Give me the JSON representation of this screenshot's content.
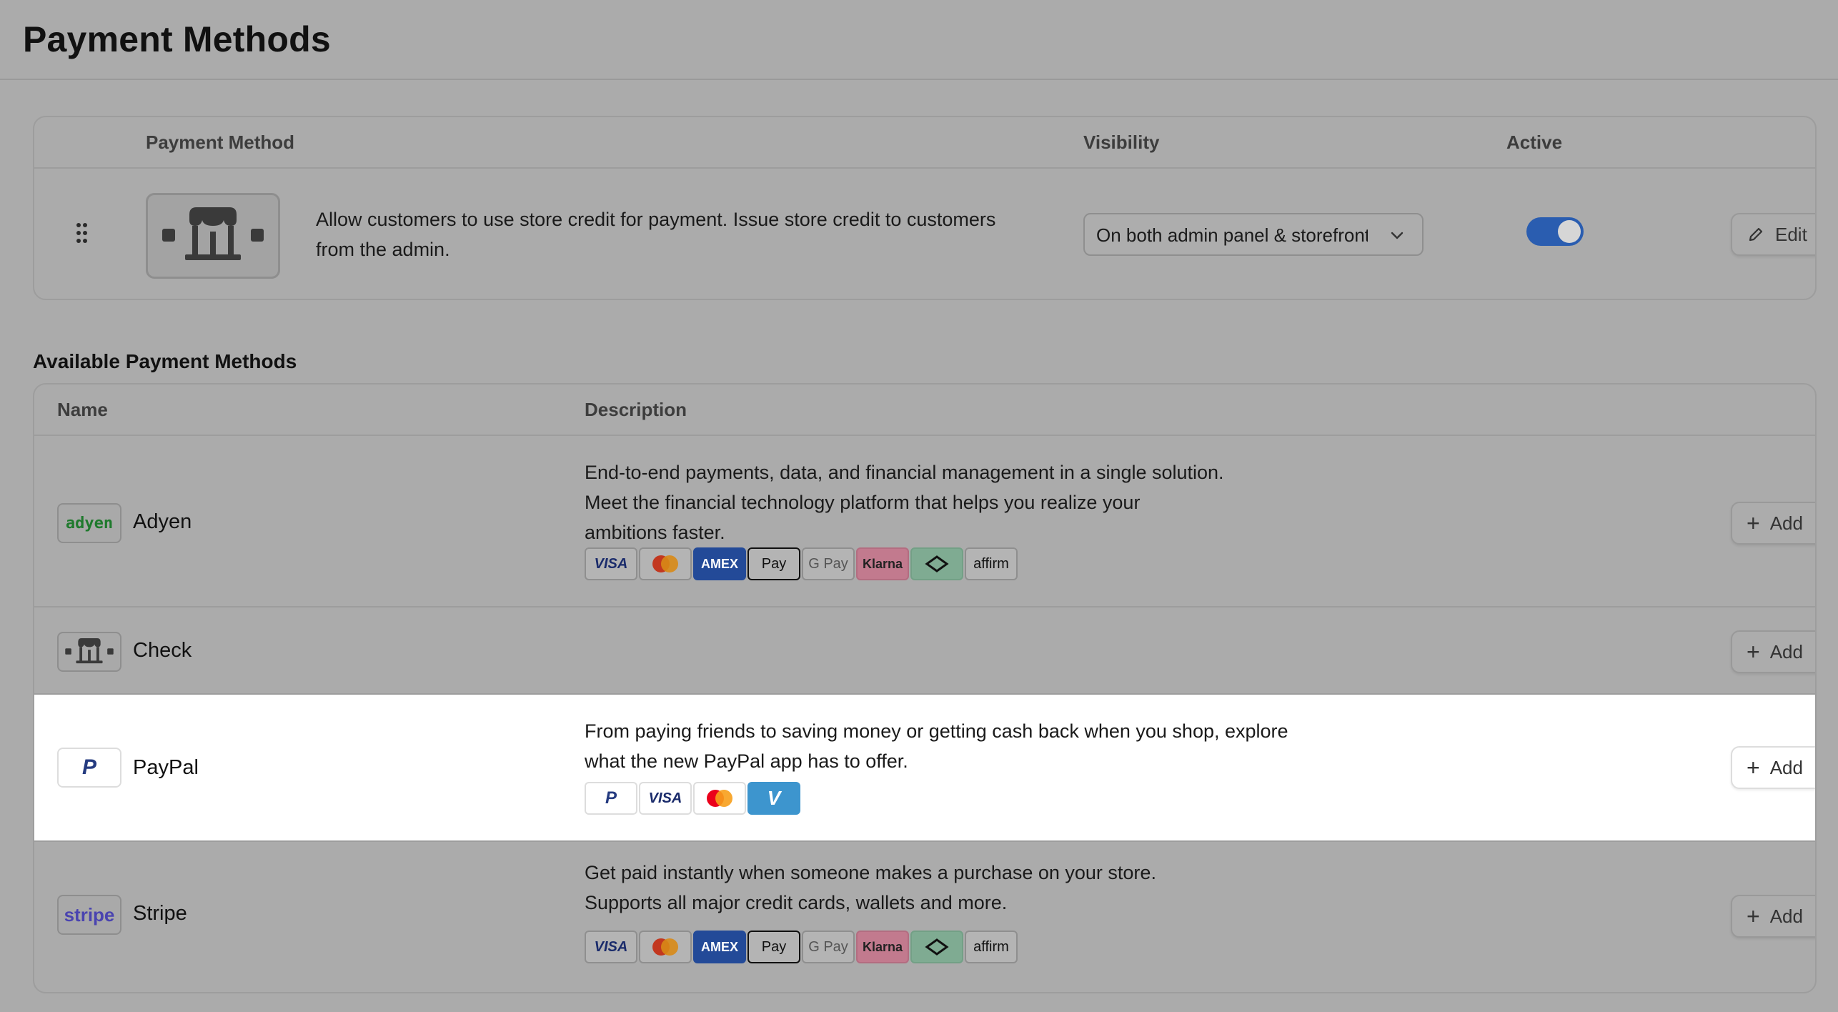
{
  "page": {
    "title": "Payment Methods"
  },
  "active_table": {
    "headers": {
      "method": "Payment Method",
      "visibility": "Visibility",
      "active": "Active"
    },
    "row": {
      "description": "Allow customers to use store credit for payment. Issue store credit to customers from the admin.",
      "visibility_value": "On both admin panel & storefront",
      "active": true,
      "edit_label": "Edit"
    }
  },
  "available": {
    "title": "Available Payment Methods",
    "headers": {
      "name": "Name",
      "description": "Description"
    },
    "add_label": "Add",
    "rows": [
      {
        "name": "Adyen",
        "logo_text": "adyen",
        "description": "End-to-end payments, data, and financial management in a single solution. Meet the financial technology platform that helps you realize your ambitions faster.",
        "icons": [
          "VISA",
          "mastercard",
          "AMEX",
          "Pay",
          "G Pay",
          "Klarna",
          "afterpay",
          "affirm"
        ]
      },
      {
        "name": "Check",
        "logo_text": "",
        "description": "",
        "icons": []
      },
      {
        "name": "PayPal",
        "logo_text": "P",
        "description": "From paying friends to saving money or getting cash back when you shop, explore what the new PayPal app has to offer.",
        "icons": [
          "P",
          "VISA",
          "mastercard",
          "V"
        ]
      },
      {
        "name": "Stripe",
        "logo_text": "stripe",
        "description": "Get paid instantly when someone makes a purchase on your store. Supports all major credit cards, wallets and more.",
        "icons": [
          "VISA",
          "mastercard",
          "AMEX",
          "Pay",
          "G Pay",
          "Klarna",
          "afterpay",
          "affirm"
        ]
      }
    ]
  },
  "colors": {
    "background": "#ababab",
    "toggle_on": "#2a5db0",
    "highlight_row": "#ffffff"
  }
}
